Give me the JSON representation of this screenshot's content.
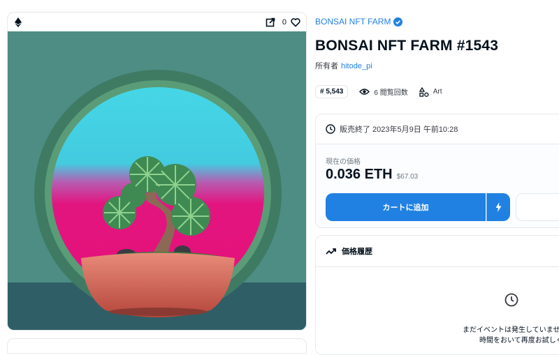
{
  "card": {
    "favorites_count": "0",
    "icons": [
      "ethereum-icon",
      "external-link-icon",
      "heart-icon"
    ]
  },
  "collection": {
    "name": "BONSAI NFT FARM"
  },
  "item": {
    "title": "BONSAI NFT FARM #1543",
    "owner_label": "所有者",
    "owner_name": "hitode_pi"
  },
  "stats": {
    "rank": "# 5,543",
    "views": "6 閲覧回数",
    "category": "Art"
  },
  "sale": {
    "end_text": "販売終了 2023年5月9日 午前10:28",
    "current_price_label": "現在の価格",
    "price": "0.036 ETH",
    "price_usd": "$67.03",
    "add_to_cart_label": "カートに追加"
  },
  "price_history": {
    "title": "価格履歴",
    "empty_line1": "まだイベントは発生していません",
    "empty_line2": "時間をおいて再度お試しください"
  },
  "colors": {
    "accent": "#2081e2",
    "text": "#04111d",
    "border": "#e5e8eb"
  }
}
